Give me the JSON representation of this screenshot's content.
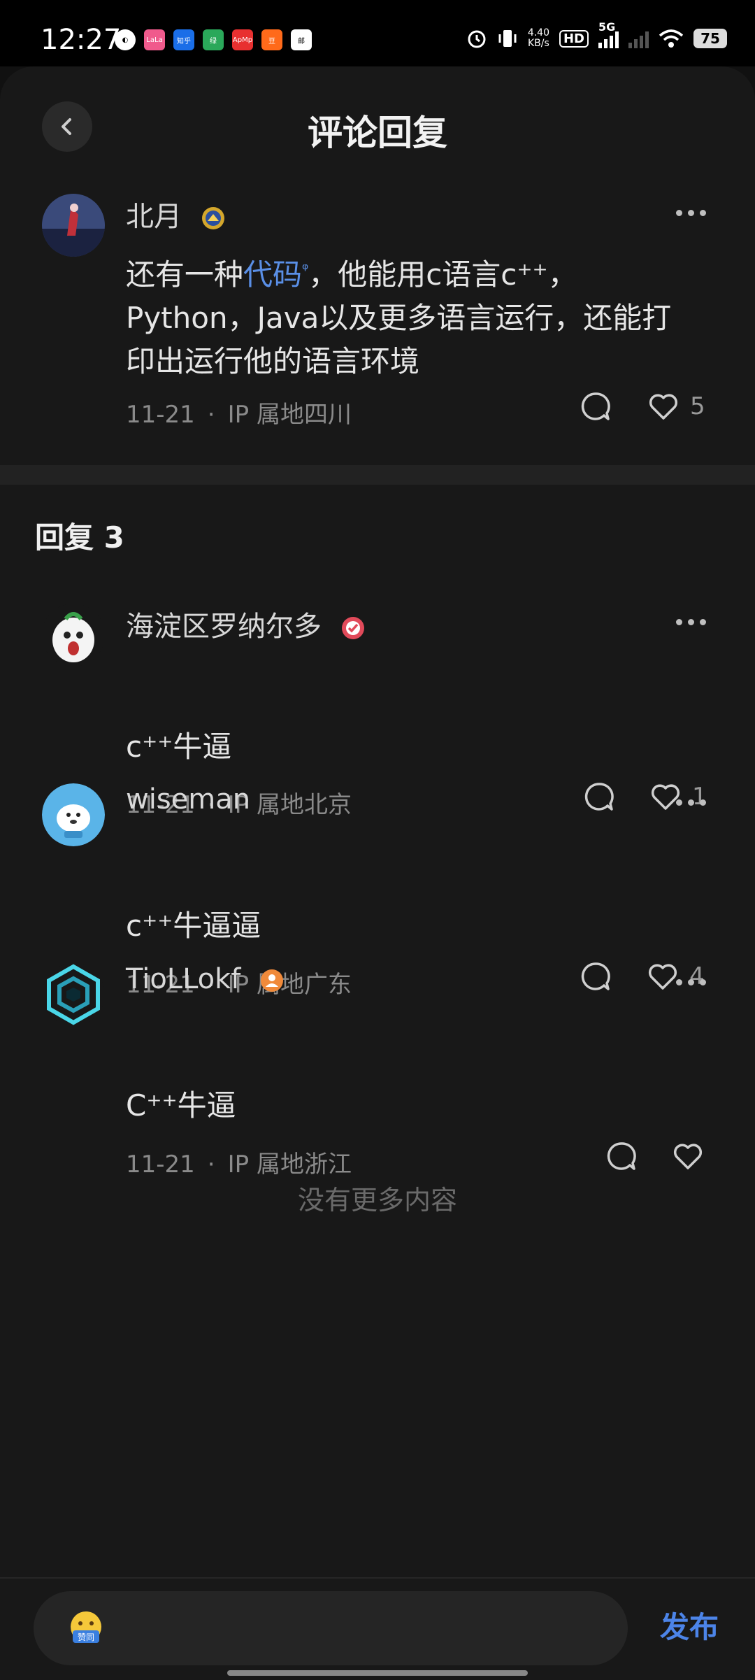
{
  "status_bar": {
    "time": "12:27",
    "net_speed_top": "4.40",
    "net_speed_unit": "KB/s",
    "hd_label": "HD",
    "network": "5G",
    "battery": "75",
    "apps": [
      "LaLa",
      "知乎",
      "绿",
      "ApMp",
      "豆",
      "邮"
    ]
  },
  "header": {
    "title": "评论回复"
  },
  "main_comment": {
    "user": "北月",
    "text_before_link": "还有一种",
    "link_text": "代码",
    "text_line1_after": "，他能用c语言c⁺⁺，",
    "text_line2": "Python，Java以及更多语言运行，还能打",
    "text_line3": "印出运行他的语言环境",
    "date": "11-21",
    "ip": "IP 属地四川",
    "likes": "5"
  },
  "replies_section": {
    "title": "回复 3"
  },
  "replies": [
    {
      "user": "海淀区罗纳尔多",
      "text": "c⁺⁺牛逼",
      "date": "11-21",
      "ip": "IP 属地北京",
      "likes": "1"
    },
    {
      "user": "wiseman",
      "text": "c⁺⁺牛逼逼",
      "date": "11-21",
      "ip": "IP 属地广东",
      "likes": "4"
    },
    {
      "user": "TioLLokf",
      "text": "C⁺⁺牛逼",
      "date": "11-21",
      "ip": "IP 属地浙江",
      "likes": ""
    }
  ],
  "footer_note": "没有更多内容",
  "bottom_bar": {
    "emoji_label": "赞同",
    "publish_label": "发布"
  },
  "colors": {
    "link": "#5a8fe6",
    "publish": "#4c84e8",
    "background": "#181818"
  }
}
